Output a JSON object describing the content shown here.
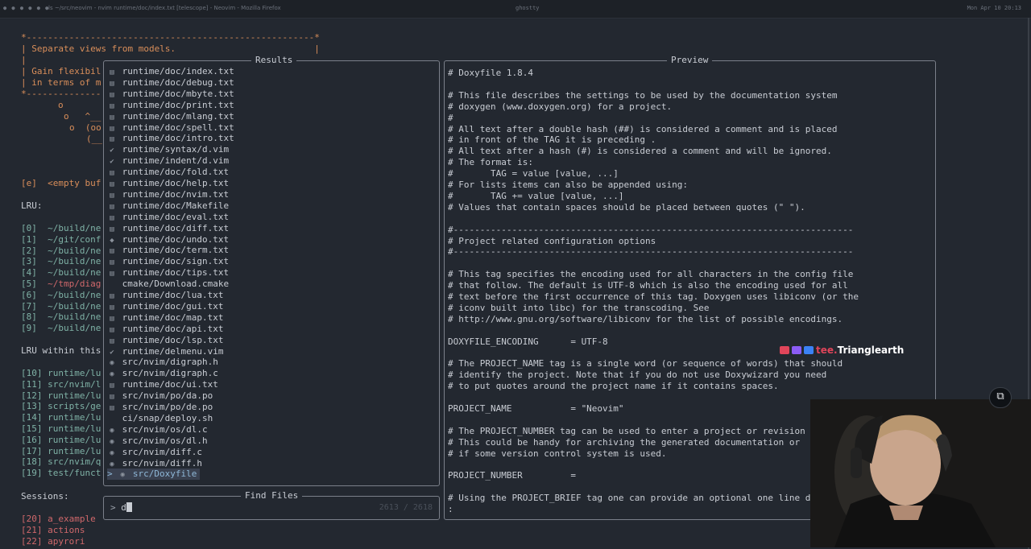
{
  "window": {
    "title": "ls ~/src/neovim - nvim runtime/doc/index.txt [telescope] - Neovim - Mozilla Firefox",
    "title2": "ghostty",
    "tray": "Mon Apr 10  20:13"
  },
  "background": {
    "banner_top": "*------------------------------------------------------*",
    "banner_1": "| Separate views from models.                          |",
    "banner_2": "|",
    "banner_3": "| Gain flexibil",
    "banner_4": "| in terms of m",
    "banner_bottom": "*--------------",
    "cow_1": "o",
    "cow_2": "o   ^__",
    "cow_3": "o  (oo",
    "cow_4": "(__",
    "empty_buf": "[e]  <empty buf",
    "lru_header": "LRU:",
    "lru_items": [
      {
        "idx": "[0]",
        "path": "~/build/ne",
        "color": "teal"
      },
      {
        "idx": "[1]",
        "path": "~/git/conf",
        "color": "teal"
      },
      {
        "idx": "[2]",
        "path": "~/build/ne",
        "color": "teal"
      },
      {
        "idx": "[3]",
        "path": "~/build/ne",
        "color": "teal"
      },
      {
        "idx": "[4]",
        "path": "~/build/ne",
        "color": "teal"
      },
      {
        "idx": "[5]",
        "path": "~/tmp/diag",
        "color": "red"
      },
      {
        "idx": "[6]",
        "path": "~/build/ne",
        "color": "teal"
      },
      {
        "idx": "[7]",
        "path": "~/build/ne",
        "color": "teal"
      },
      {
        "idx": "[8]",
        "path": "~/build/ne",
        "color": "teal"
      },
      {
        "idx": "[9]",
        "path": "~/build/ne",
        "color": "teal"
      }
    ],
    "lru_within_header": "LRU within this",
    "lru_within_items": [
      {
        "idx": "[10]",
        "path": "runtime/lu"
      },
      {
        "idx": "[11]",
        "path": "src/nvim/l"
      },
      {
        "idx": "[12]",
        "path": "runtime/lu"
      },
      {
        "idx": "[13]",
        "path": "scripts/ge"
      },
      {
        "idx": "[14]",
        "path": "runtime/lu"
      },
      {
        "idx": "[15]",
        "path": "runtime/lu"
      },
      {
        "idx": "[16]",
        "path": "runtime/lu"
      },
      {
        "idx": "[17]",
        "path": "runtime/lu"
      },
      {
        "idx": "[18]",
        "path": "src/nvim/q"
      },
      {
        "idx": "[19]",
        "path": "test/funct"
      }
    ],
    "sessions_header": "Sessions:",
    "sessions": [
      {
        "idx": "[20]",
        "name": "a_example"
      },
      {
        "idx": "[21]",
        "name": "actions"
      },
      {
        "idx": "[22]",
        "name": "apyrori"
      }
    ]
  },
  "results": {
    "title": "Results",
    "items": [
      {
        "icon": "txt-icon",
        "glyph": "▤",
        "path": "runtime/doc/index.txt"
      },
      {
        "icon": "txt-icon",
        "glyph": "▤",
        "path": "runtime/doc/debug.txt"
      },
      {
        "icon": "txt-icon",
        "glyph": "▤",
        "path": "runtime/doc/mbyte.txt"
      },
      {
        "icon": "txt-icon",
        "glyph": "▤",
        "path": "runtime/doc/print.txt"
      },
      {
        "icon": "txt-icon",
        "glyph": "▤",
        "path": "runtime/doc/mlang.txt"
      },
      {
        "icon": "txt-icon",
        "glyph": "▤",
        "path": "runtime/doc/spell.txt"
      },
      {
        "icon": "txt-icon",
        "glyph": "▤",
        "path": "runtime/doc/intro.txt"
      },
      {
        "icon": "vim-icon",
        "glyph": "✔",
        "path": "runtime/syntax/d.vim"
      },
      {
        "icon": "vim-icon",
        "glyph": "✔",
        "path": "runtime/indent/d.vim"
      },
      {
        "icon": "txt-icon",
        "glyph": "▤",
        "path": "runtime/doc/fold.txt"
      },
      {
        "icon": "txt-icon",
        "glyph": "▤",
        "path": "runtime/doc/help.txt"
      },
      {
        "icon": "txt-icon",
        "glyph": "▤",
        "path": "runtime/doc/nvim.txt"
      },
      {
        "icon": "makefile-icon",
        "glyph": "▤",
        "path": "runtime/doc/Makefile"
      },
      {
        "icon": "txt-icon",
        "glyph": "▤",
        "path": "runtime/doc/eval.txt"
      },
      {
        "icon": "txt-icon",
        "glyph": "▤",
        "path": "runtime/doc/diff.txt"
      },
      {
        "icon": "txt-icon",
        "glyph": "◆",
        "path": "runtime/doc/undo.txt"
      },
      {
        "icon": "txt-icon",
        "glyph": "▤",
        "path": "runtime/doc/term.txt"
      },
      {
        "icon": "txt-icon",
        "glyph": "▤",
        "path": "runtime/doc/sign.txt"
      },
      {
        "icon": "txt-icon",
        "glyph": "▤",
        "path": "runtime/doc/tips.txt"
      },
      {
        "icon": "cmake-icon",
        "glyph": " ",
        "path": "cmake/Download.cmake"
      },
      {
        "icon": "txt-icon",
        "glyph": "▤",
        "path": "runtime/doc/lua.txt"
      },
      {
        "icon": "txt-icon",
        "glyph": "▤",
        "path": "runtime/doc/gui.txt"
      },
      {
        "icon": "txt-icon",
        "glyph": "▤",
        "path": "runtime/doc/map.txt"
      },
      {
        "icon": "txt-icon",
        "glyph": "▤",
        "path": "runtime/doc/api.txt"
      },
      {
        "icon": "txt-icon",
        "glyph": "▤",
        "path": "runtime/doc/lsp.txt"
      },
      {
        "icon": "vim-icon",
        "glyph": "✔",
        "path": "runtime/delmenu.vim"
      },
      {
        "icon": "c-header-icon",
        "glyph": "◉",
        "path": "src/nvim/digraph.h"
      },
      {
        "icon": "c-source-icon",
        "glyph": "◉",
        "path": "src/nvim/digraph.c"
      },
      {
        "icon": "txt-icon",
        "glyph": "▤",
        "path": "runtime/doc/ui.txt"
      },
      {
        "icon": "po-icon",
        "glyph": "▤",
        "path": "src/nvim/po/da.po"
      },
      {
        "icon": "po-icon",
        "glyph": "▤",
        "path": "src/nvim/po/de.po"
      },
      {
        "icon": "shell-icon",
        "glyph": " ",
        "path": "ci/snap/deploy.sh"
      },
      {
        "icon": "c-source-icon",
        "glyph": "◉",
        "path": "src/nvim/os/dl.c"
      },
      {
        "icon": "c-header-icon",
        "glyph": "◉",
        "path": "src/nvim/os/dl.h"
      },
      {
        "icon": "c-source-icon",
        "glyph": "◉",
        "path": "src/nvim/diff.c"
      },
      {
        "icon": "c-header-icon",
        "glyph": "◉",
        "path": "src/nvim/diff.h"
      },
      {
        "icon": "file-icon",
        "glyph": "◉",
        "path": "src/Doxyfile",
        "selected": true
      }
    ],
    "selection_marker": ">"
  },
  "preview": {
    "title": "Preview",
    "lines": [
      "# Doxyfile 1.8.4",
      "",
      "# This file describes the settings to be used by the documentation system",
      "# doxygen (www.doxygen.org) for a project.",
      "#",
      "# All text after a double hash (##) is considered a comment and is placed",
      "# in front of the TAG it is preceding .",
      "# All text after a hash (#) is considered a comment and will be ignored.",
      "# The format is:",
      "#       TAG = value [value, ...]",
      "# For lists items can also be appended using:",
      "#       TAG += value [value, ...]",
      "# Values that contain spaces should be placed between quotes (\" \").",
      "",
      "#---------------------------------------------------------------------------",
      "# Project related configuration options",
      "#---------------------------------------------------------------------------",
      "",
      "# This tag specifies the encoding used for all characters in the config file",
      "# that follow. The default is UTF-8 which is also the encoding used for all",
      "# text before the first occurrence of this tag. Doxygen uses libiconv (or the",
      "# iconv built into libc) for the transcoding. See",
      "# http://www.gnu.org/software/libiconv for the list of possible encodings.",
      "",
      "DOXYFILE_ENCODING      = UTF-8",
      "",
      "# The PROJECT_NAME tag is a single word (or sequence of words) that should",
      "# identify the project. Note that if you do not use Doxywizard you need",
      "# to put quotes around the project name if it contains spaces.",
      "",
      "PROJECT_NAME           = \"Neovim\"",
      "",
      "# The PROJECT_NUMBER tag can be used to enter a project or revision number.",
      "# This could be handy for archiving the generated documentation or",
      "# if some version control system is used.",
      "",
      "PROJECT_NUMBER         =",
      "",
      "# Using the PROJECT_BRIEF tag one can provide an optional one line descripti",
      ":"
    ]
  },
  "prompt": {
    "title": "Find Files",
    "prefix": ">",
    "value": "d",
    "count": "2613 / 2618"
  },
  "overlay": {
    "tag": "tee.",
    "name": "Trianglearth",
    "pip_icon": "picture-in-picture-icon"
  },
  "colors": {
    "background": "#232830",
    "border": "#7b808a",
    "accent_orange": "#d98e5a",
    "accent_red": "#d0686b",
    "accent_teal": "#7fb2a6",
    "selection": "#3a4150"
  }
}
